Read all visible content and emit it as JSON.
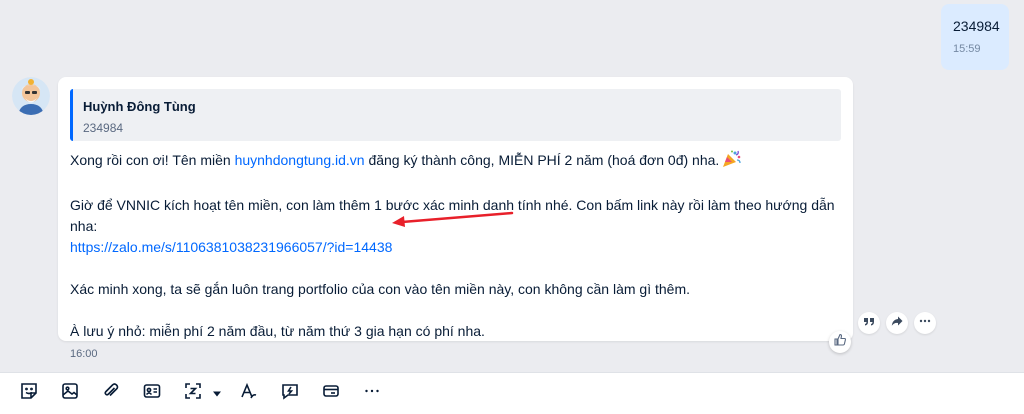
{
  "my_message": {
    "text": "234984",
    "time": "15:59"
  },
  "incoming": {
    "quote": {
      "name": "Huỳnh Đông Tùng",
      "text": "234984"
    },
    "line1_before": "Xong rồi con ơi! Tên miền ",
    "line1_link": "huynhdongtung.id.vn",
    "line1_after": " đăng ký thành công, MIỄN PHÍ 2 năm (hoá đơn 0đ) nha.",
    "line2": "Giờ để VNNIC kích hoạt tên miền, con làm thêm 1 bước xác minh danh tính nhé. Con bấm link này rồi làm theo hướng dẫn nha:",
    "link": "https://zalo.me/s/1106381038231966057/?id=14438",
    "line3": "Xác minh xong, ta sẽ gắn luôn trang portfolio của con vào tên miền này, con không cần làm gì thêm.",
    "line4": "À lưu ý nhỏ: miễn phí 2 năm đầu, từ năm thứ 3 gia hạn có phí nha.",
    "time": "16:00"
  },
  "colors": {
    "link": "#0068ff",
    "accent": "#0068ff",
    "annotation_arrow": "#e8202a"
  },
  "icons": {
    "message_actions": [
      "quote-icon",
      "forward-icon",
      "more-icon"
    ],
    "toolbar": [
      "sticker-icon",
      "image-icon",
      "attachment-icon",
      "contact-card-icon",
      "screenshot-icon",
      "dropdown-caret-icon",
      "text-format-icon",
      "urgent-icon",
      "transfer-icon",
      "more-icon"
    ]
  }
}
